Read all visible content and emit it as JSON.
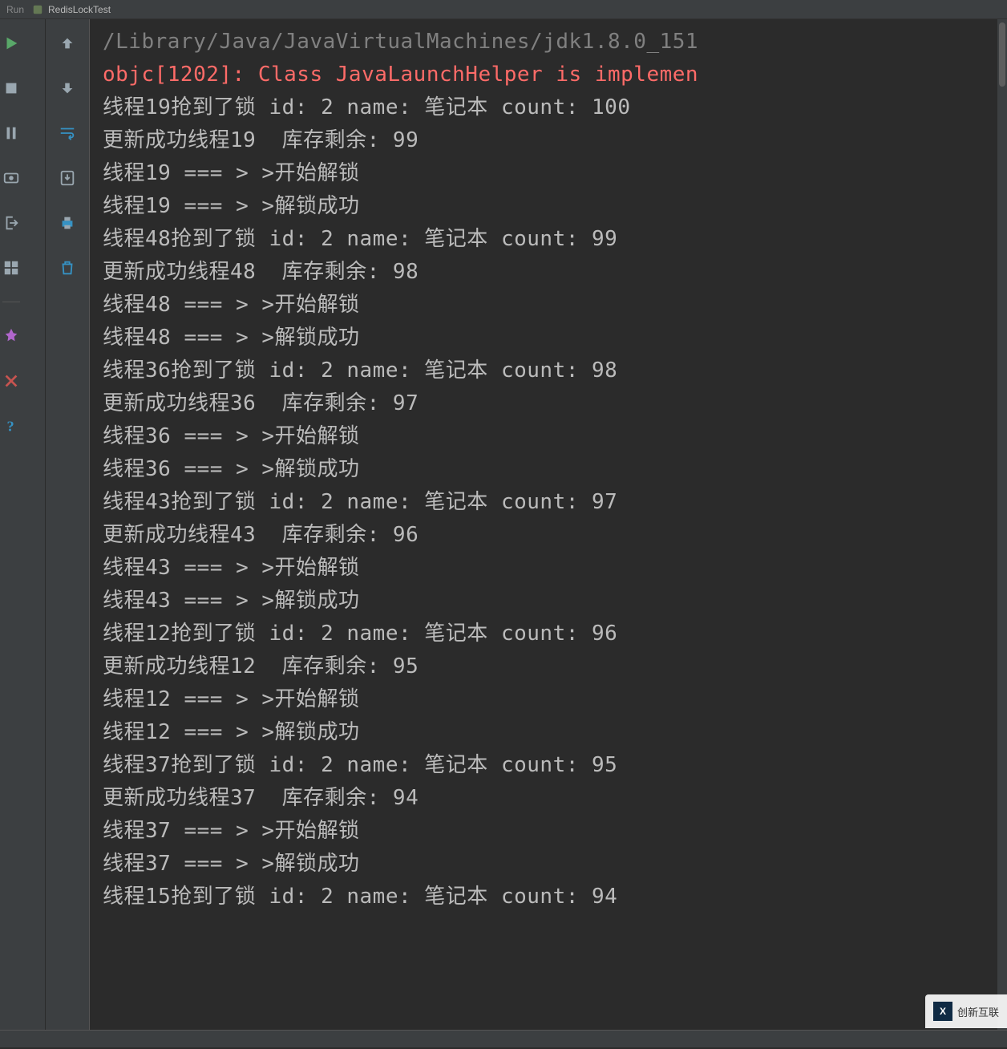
{
  "header": {
    "run_label": "Run",
    "tab_name": "RedisLockTest"
  },
  "watermark": {
    "text": "创新互联"
  },
  "console_lines": [
    {
      "cls": "gray",
      "text": "/Library/Java/JavaVirtualMachines/jdk1.8.0_151"
    },
    {
      "cls": "red",
      "text": "objc[1202]: Class JavaLaunchHelper is implemen"
    },
    {
      "cls": "txt",
      "text": "线程19抢到了锁 id: 2 name: 笔记本 count: 100"
    },
    {
      "cls": "txt",
      "text": "更新成功线程19  库存剩余: 99"
    },
    {
      "cls": "txt",
      "text": "线程19 === > >开始解锁"
    },
    {
      "cls": "txt",
      "text": "线程19 === > >解锁成功"
    },
    {
      "cls": "txt",
      "text": "线程48抢到了锁 id: 2 name: 笔记本 count: 99"
    },
    {
      "cls": "txt",
      "text": "更新成功线程48  库存剩余: 98"
    },
    {
      "cls": "txt",
      "text": "线程48 === > >开始解锁"
    },
    {
      "cls": "txt",
      "text": "线程48 === > >解锁成功"
    },
    {
      "cls": "txt",
      "text": "线程36抢到了锁 id: 2 name: 笔记本 count: 98"
    },
    {
      "cls": "txt",
      "text": "更新成功线程36  库存剩余: 97"
    },
    {
      "cls": "txt",
      "text": "线程36 === > >开始解锁"
    },
    {
      "cls": "txt",
      "text": "线程36 === > >解锁成功"
    },
    {
      "cls": "txt",
      "text": "线程43抢到了锁 id: 2 name: 笔记本 count: 97"
    },
    {
      "cls": "txt",
      "text": "更新成功线程43  库存剩余: 96"
    },
    {
      "cls": "txt",
      "text": "线程43 === > >开始解锁"
    },
    {
      "cls": "txt",
      "text": "线程43 === > >解锁成功"
    },
    {
      "cls": "txt",
      "text": "线程12抢到了锁 id: 2 name: 笔记本 count: 96"
    },
    {
      "cls": "txt",
      "text": "更新成功线程12  库存剩余: 95"
    },
    {
      "cls": "txt",
      "text": "线程12 === > >开始解锁"
    },
    {
      "cls": "txt",
      "text": "线程12 === > >解锁成功"
    },
    {
      "cls": "txt",
      "text": "线程37抢到了锁 id: 2 name: 笔记本 count: 95"
    },
    {
      "cls": "txt",
      "text": "更新成功线程37  库存剩余: 94"
    },
    {
      "cls": "txt",
      "text": "线程37 === > >开始解锁"
    },
    {
      "cls": "txt",
      "text": "线程37 === > >解锁成功"
    },
    {
      "cls": "txt",
      "text": "线程15抢到了锁 id: 2 name: 笔记本 count: 94"
    }
  ]
}
